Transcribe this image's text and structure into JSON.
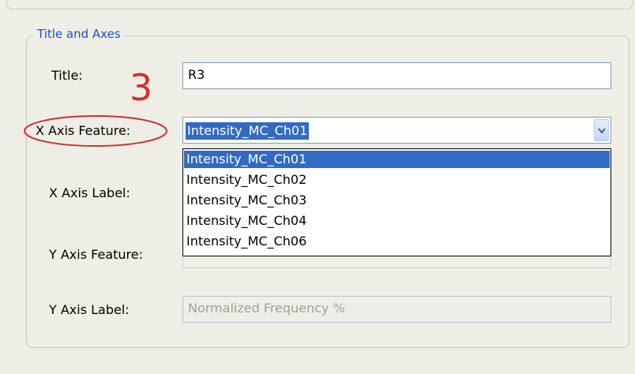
{
  "group": {
    "title": "Title and Axes"
  },
  "fields": {
    "title_label": "Title:",
    "title_value": "R3",
    "x_feature_label": "X Axis Feature:",
    "x_feature_value": "Intensity_MC_Ch01",
    "x_label_label": "X Axis Label:",
    "y_feature_label": "Y Axis Feature:",
    "y_label_label": "Y Axis Label:",
    "y_label_value": "Normalized Frequency %"
  },
  "dropdown": {
    "options": [
      "Intensity_MC_Ch01",
      "Intensity_MC_Ch02",
      "Intensity_MC_Ch03",
      "Intensity_MC_Ch04",
      "Intensity_MC_Ch06"
    ],
    "selected_index": 0
  },
  "annotation": {
    "step": "3",
    "color": "#d42e2e"
  },
  "colors": {
    "selection": "#316ac5",
    "group_title": "#1a4fd6"
  }
}
